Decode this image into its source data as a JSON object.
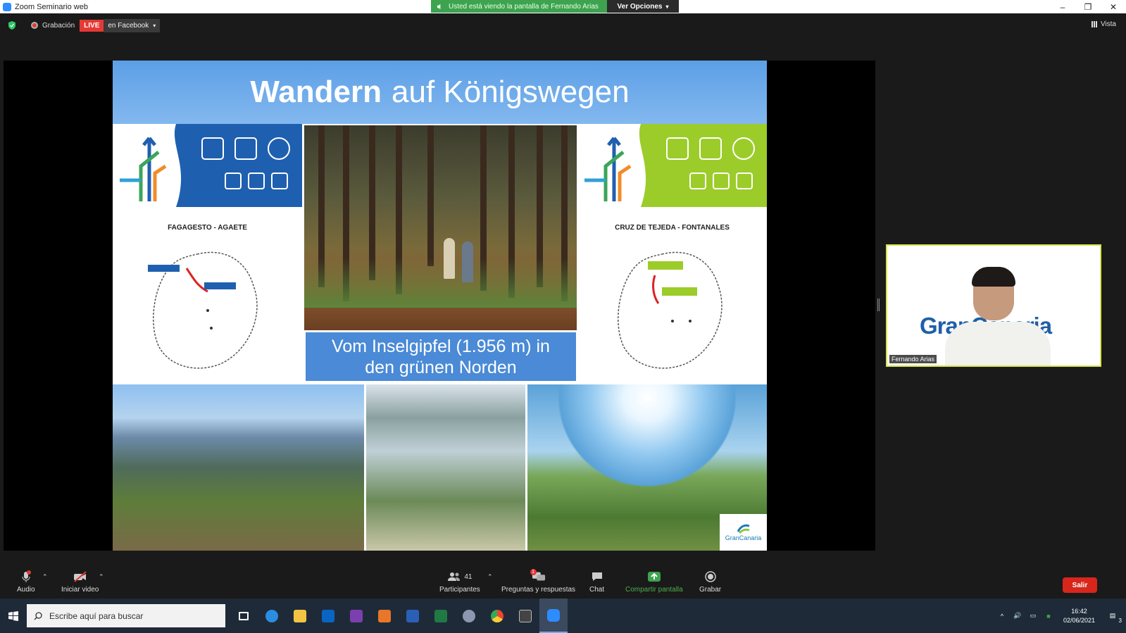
{
  "window": {
    "title": "Zoom Seminario web",
    "share_banner": "Usted está viendo la pantalla de Fernando Arias",
    "view_options": "Ver Opciones"
  },
  "meeting": {
    "recording_label": "Grabación",
    "live_label": "LIVE",
    "stream_target": "en Facebook",
    "view_label": "Vista"
  },
  "slide": {
    "title_bold": "Wandern",
    "title_rest": "auf Königswegen",
    "route_left": "FAGAGESTO - AGAETE",
    "route_right": "CRUZ DE TEJEDA - FONTANALES",
    "caption_line1": "Vom Inselgipfel (1.956 m) in",
    "caption_line2": "den grünen Norden",
    "logo_text": "GranCanaria"
  },
  "participant": {
    "name": "Fernando Arias",
    "background_brand": "GranCanaria"
  },
  "toolbar": {
    "audio": "Audio",
    "video": "Iniciar video",
    "participants": "Participantes",
    "participants_count": "41",
    "qa": "Preguntas y respuestas",
    "qa_badge": "1",
    "chat": "Chat",
    "share": "Compartir pantalla",
    "record": "Grabar",
    "leave": "Salir"
  },
  "taskbar": {
    "search_placeholder": "Escribe aquí para buscar",
    "time": "16:42",
    "date": "02/06/2021",
    "notif_count": "3"
  },
  "colors": {
    "live_red": "#e53935",
    "share_green": "#3da34f",
    "slide_blue": "#4a8ad6",
    "thumb_border": "#d6e44a"
  }
}
